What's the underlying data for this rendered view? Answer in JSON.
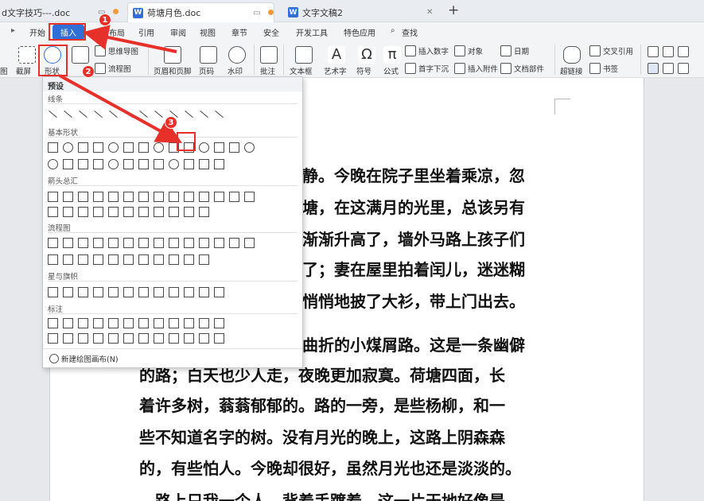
{
  "tabs": [
    {
      "label": "d文字技巧---.doc"
    },
    {
      "label": "荷塘月色.doc"
    },
    {
      "label": "文字文稿2"
    }
  ],
  "tab_new": "+",
  "menu": [
    "开始",
    "插入",
    "页面布局",
    "引用",
    "审阅",
    "视图",
    "章节",
    "安全",
    "开发工具",
    "特色应用",
    "查找"
  ],
  "ribbon": {
    "crop": "截屏",
    "shapes": "形状",
    "mindmap": "思维导图",
    "flowchart": "流程图",
    "header_footer": "页眉和页脚",
    "page_num": "页码",
    "watermark": "水印",
    "comment": "批注",
    "textbox": "文本框",
    "art": "艺术字",
    "symbol": "符号",
    "formula": "公式",
    "insert_number": "插入数字",
    "drop_cap": "首字下沉",
    "object": "对象",
    "attach": "插入附件",
    "date": "日期",
    "doc_parts": "文档部件",
    "hyperlink": "超链接",
    "crossref": "交叉引用",
    "bookmark": "书签",
    "left_edge": "图"
  },
  "dropdown": {
    "header": "预设",
    "sections": [
      "线条",
      "基本形状",
      "箭头总汇",
      "流程图",
      "星与旗帜",
      "标注"
    ],
    "footer": "新建绘图画布(N)"
  },
  "badges": [
    "1",
    "2",
    "3"
  ],
  "doc_lines": [
    "静。今晚在院子里坐着乘凉，忽",
    "塘，在这满月的光里，总该另有",
    "渐渐升高了，墙外马路上孩子们",
    "了；妻在屋里拍着闰儿，迷迷糊",
    "悄悄地披了大衫，带上门出去。",
    "曲折的小煤屑路。这是一条幽僻",
    "的路；白天也少人走，夜晚更加寂寞。荷塘四面，长",
    "着许多树，蓊蓊郁郁的。路的一旁，是些杨柳，和一",
    "些不知道名字的树。没有月光的晚上，这路上阴森森",
    "的，有些怕人。今晚却很好，虽然月光也还是淡淡的。",
    "路上只我一个人，背着手踱着。这一片天地好像是"
  ],
  "colors": {
    "accent": "#2f6fd6",
    "highlight": "#e8302a"
  }
}
